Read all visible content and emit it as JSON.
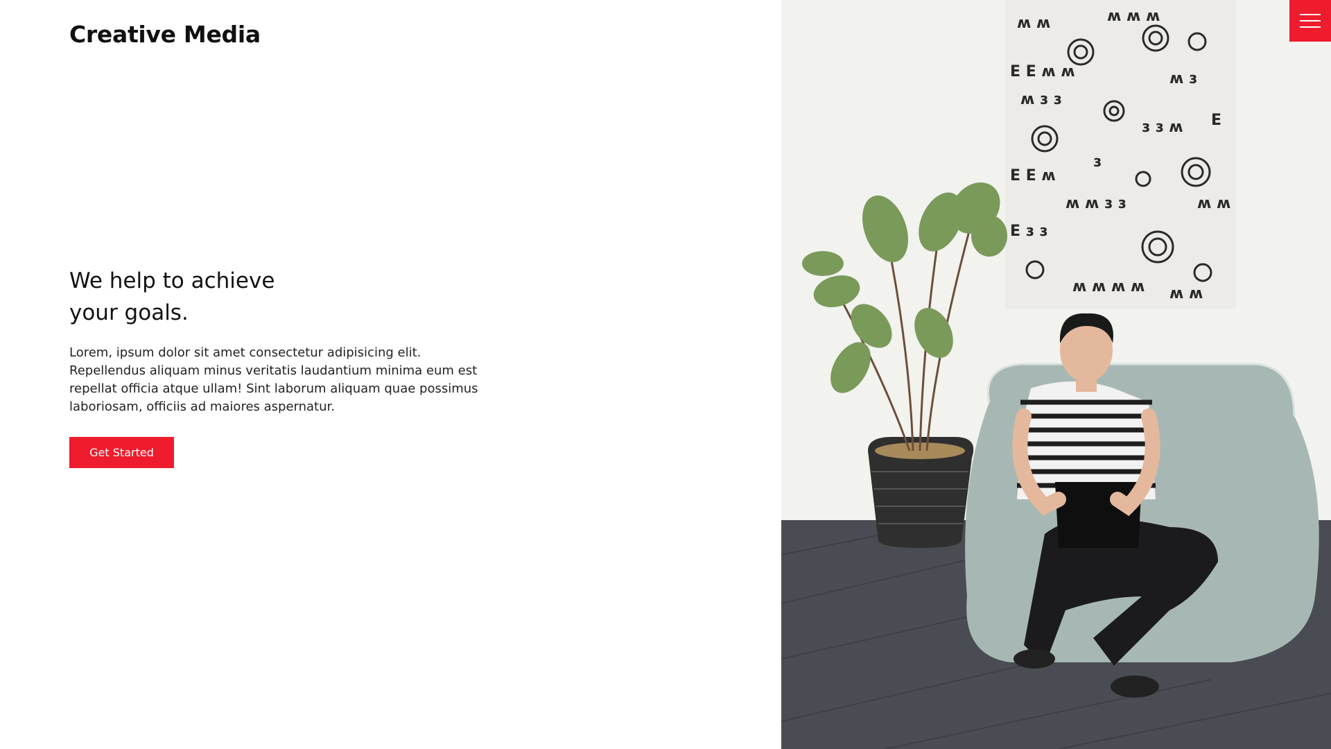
{
  "header": {
    "brand": "Creative Media",
    "menu_icon": "hamburger-menu-icon"
  },
  "hero": {
    "headline": "We help to achieve your goals.",
    "body": "Lorem, ipsum dolor sit amet consectetur adipisicing elit. Repellendus aliquam minus veritatis laudantium minima eum est repellat officia atque ullam! Sint laborum aliquam quae possimus laboriosam, officiis ad maiores aspernatur.",
    "cta_label": "Get Started"
  },
  "colors": {
    "accent": "#ef1c2d",
    "text": "#111111",
    "background": "#ffffff"
  }
}
